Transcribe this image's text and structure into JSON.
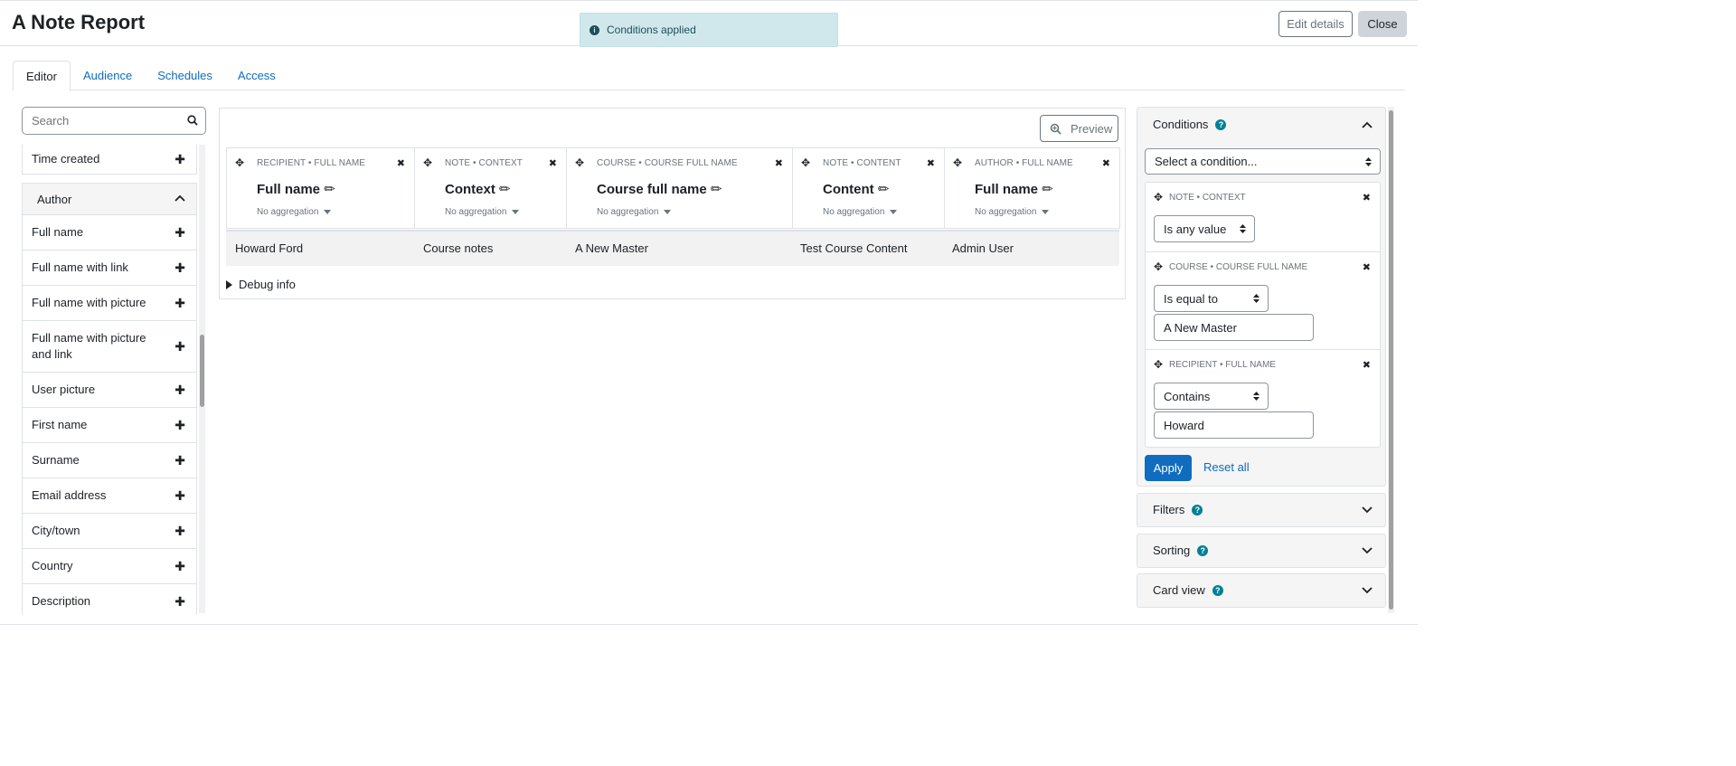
{
  "header": {
    "title": "A Note Report",
    "edit_label": "Edit details",
    "close_label": "Close"
  },
  "toast": {
    "message": "Conditions applied"
  },
  "tabs": [
    {
      "label": "Editor",
      "active": true
    },
    {
      "label": "Audience",
      "active": false
    },
    {
      "label": "Schedules",
      "active": false
    },
    {
      "label": "Access",
      "active": false
    }
  ],
  "sidebar": {
    "search_placeholder": "Search",
    "time_created": "Time created",
    "group_title": "Author",
    "items": [
      "Full name",
      "Full name with link",
      "Full name with picture",
      "Full name with picture and link",
      "User picture",
      "First name",
      "Surname",
      "Email address",
      "City/town",
      "Country",
      "Description"
    ]
  },
  "main": {
    "preview_label": "Preview",
    "columns": [
      {
        "category": "RECIPIENT • FULL NAME",
        "name": "Full name",
        "aggregation": "No aggregation"
      },
      {
        "category": "NOTE • CONTEXT",
        "name": "Context",
        "aggregation": "No aggregation"
      },
      {
        "category": "COURSE • COURSE FULL NAME",
        "name": "Course full name",
        "aggregation": "No aggregation"
      },
      {
        "category": "NOTE • CONTENT",
        "name": "Content",
        "aggregation": "No aggregation"
      },
      {
        "category": "AUTHOR • FULL NAME",
        "name": "Full name",
        "aggregation": "No aggregation"
      }
    ],
    "row": [
      "Howard Ford",
      "Course notes",
      "A New Master",
      "Test Course Content",
      "Admin User"
    ],
    "debug_label": "Debug info"
  },
  "right_panel": {
    "conditions": {
      "title": "Conditions",
      "select_placeholder": "Select a condition...",
      "items": [
        {
          "category": "NOTE • CONTEXT",
          "operator": "Is any value",
          "value": ""
        },
        {
          "category": "COURSE • COURSE FULL NAME",
          "operator": "Is equal to",
          "value": "A New Master"
        },
        {
          "category": "RECIPIENT • FULL NAME",
          "operator": "Contains",
          "value": "Howard"
        }
      ],
      "apply_label": "Apply",
      "reset_label": "Reset all"
    },
    "filters_title": "Filters",
    "sorting_title": "Sorting",
    "card_view_title": "Card view"
  },
  "colors": {
    "primary": "#0f6cbf",
    "info_bg": "#d0e8ec",
    "help_icon": "#008196"
  }
}
